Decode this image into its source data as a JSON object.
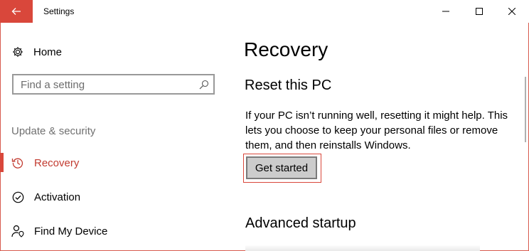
{
  "window": {
    "title": "Settings"
  },
  "titlebar": {
    "back_icon": "arrow-left-icon",
    "minimize_icon": "minimize-icon",
    "maximize_icon": "maximize-icon",
    "close_icon": "close-icon"
  },
  "sidebar": {
    "home_label": "Home",
    "search": {
      "placeholder": "Find a setting"
    },
    "section_label": "Update & security",
    "items": [
      {
        "label": "Recovery",
        "icon": "history-icon",
        "selected": true
      },
      {
        "label": "Activation",
        "icon": "check-circle-icon",
        "selected": false
      },
      {
        "label": "Find My Device",
        "icon": "person-location-icon",
        "selected": false
      }
    ]
  },
  "main": {
    "title": "Recovery",
    "reset": {
      "heading": "Reset this PC",
      "description": "If your PC isn’t running well, resetting it might help. This lets you choose to keep your personal files or remove them, and then reinstalls Windows.",
      "button_label": "Get started"
    },
    "advanced": {
      "heading": "Advanced startup"
    }
  },
  "colors": {
    "accent": "#d9473b",
    "selected_text": "#c23b30",
    "muted_text": "#707070"
  }
}
